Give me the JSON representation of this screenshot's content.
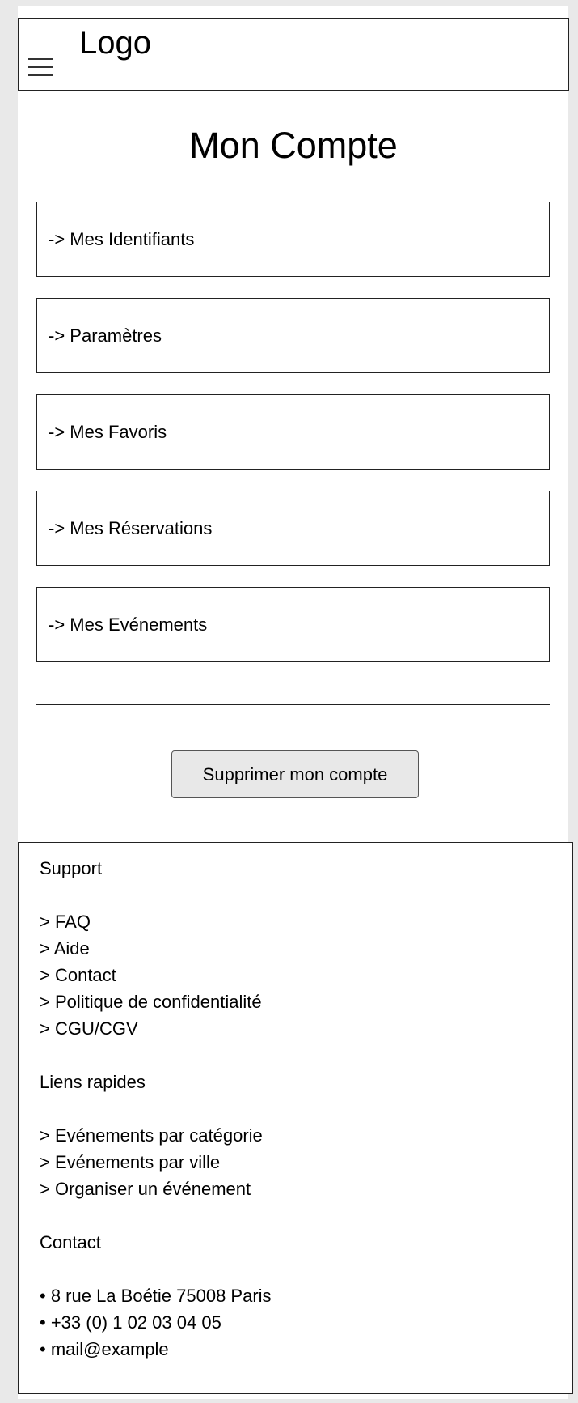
{
  "header": {
    "logo": "Logo",
    "menu_icon": "hamburger-menu-icon"
  },
  "main": {
    "title": "Mon Compte",
    "menu_items": [
      {
        "label": "-> Mes Identifiants"
      },
      {
        "label": "-> Paramètres"
      },
      {
        "label": "-> Mes Favoris"
      },
      {
        "label": "-> Mes Réservations"
      },
      {
        "label": "-> Mes Evénements"
      }
    ],
    "delete_button": "Supprimer mon compte"
  },
  "footer": {
    "support": {
      "title": "Support",
      "links": [
        "> FAQ",
        "> Aide",
        "> Contact",
        "> Politique de confidentialité",
        "> CGU/CGV"
      ]
    },
    "quick_links": {
      "title": "Liens rapides",
      "links": [
        "> Evénements par catégorie",
        "> Evénements par ville",
        "> Organiser un événement"
      ]
    },
    "contact": {
      "title": "Contact",
      "items": [
        "• 8 rue La Boétie 75008 Paris",
        "• +33 (0) 1 02 03 04 05",
        "• mail@example"
      ]
    }
  }
}
